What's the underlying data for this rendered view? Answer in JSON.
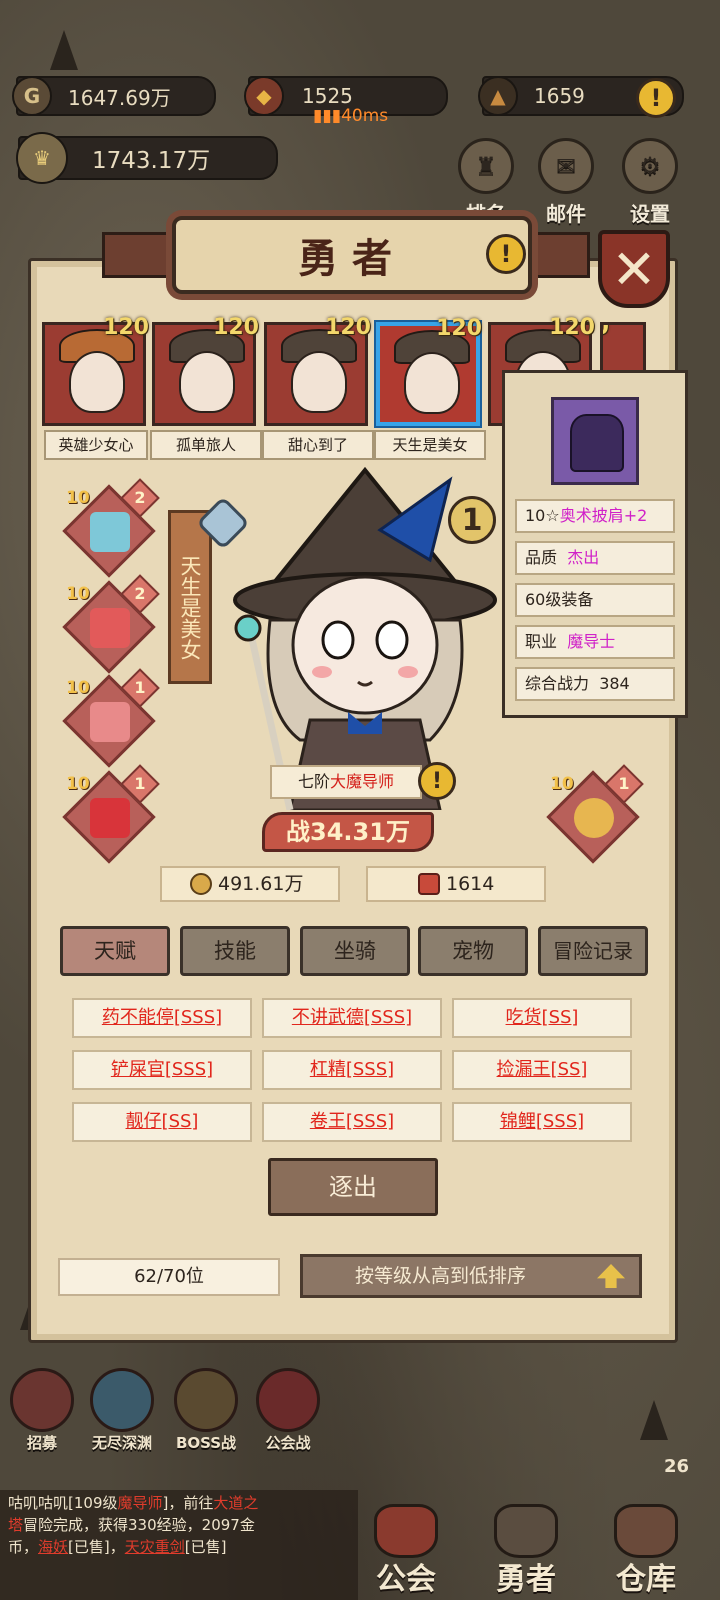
{
  "resources": {
    "gold": "1647.69万",
    "crest": "1525",
    "gem": "1659",
    "power_total": "1743.17万",
    "ping": "40ms"
  },
  "top_buttons": [
    "排名",
    "邮件",
    "设置"
  ],
  "panel": {
    "title": "勇者",
    "close_icon": "close-icon",
    "heroes": [
      {
        "name": "英雄少女心",
        "level": "120"
      },
      {
        "name": "孤单旅人",
        "level": "120"
      },
      {
        "name": "甜心到了",
        "level": "120"
      },
      {
        "name": "天生是美女",
        "level": "120"
      },
      {
        "name": "",
        "level": "120"
      },
      {
        "name": "",
        "level": "120"
      }
    ],
    "hero_title": "天生是美女",
    "equipment_left": [
      {
        "star": "10",
        "count": "2"
      },
      {
        "star": "10",
        "count": "2"
      },
      {
        "star": "10",
        "count": "1"
      },
      {
        "star": "10",
        "count": "1"
      }
    ],
    "equipment_right": [
      {
        "star": "10",
        "count": "1"
      }
    ],
    "class_prefix": "七阶",
    "class_name": "大魔导师",
    "power_glyph": "战",
    "power": "34.31万",
    "gold_cost": "491.61万",
    "scroll_cost": "1614",
    "tabs": [
      "天赋",
      "技能",
      "坐骑",
      "宠物",
      "冒险记录"
    ],
    "talents": [
      "药不能停[SSS]",
      "不讲武德[SSS]",
      "吃货[SS]",
      "铲屎官[SSS]",
      "杠精[SSS]",
      "捡漏王[SS]",
      "靓仔[SS]",
      "卷王[SSS]",
      "锦鲤[SSS]"
    ],
    "expel_label": "逐出",
    "hero_count": "62/70位",
    "sort_label": "按等级从高到低排序"
  },
  "item_info": {
    "star": "10☆",
    "name": "奥术披肩+2",
    "quality_label": "品质",
    "quality": "杰出",
    "level_req": "60级装备",
    "job_label": "职业",
    "job": "魔导士",
    "power_label": "综合战力",
    "power": "384"
  },
  "bottom_buttons": [
    "招募",
    "无尽深渊",
    "BOSS战",
    "公会战"
  ],
  "chat": {
    "line1_a": "咕叽咕叽[109级",
    "line1_b": "魔导师",
    "line1_c": "]，前往",
    "line1_d": "大道之",
    "line2_a": "塔",
    "line2_b": "冒险完成，获得330经验，2097金",
    "line3_a": "币，",
    "line3_b": "海妖",
    "line3_c": "[已售]，",
    "line3_d": "天灾重剑",
    "line3_e": "[已售]"
  },
  "nav_tabs": [
    "公会",
    "勇者",
    "仓库"
  ],
  "warehouse_badge": "26"
}
